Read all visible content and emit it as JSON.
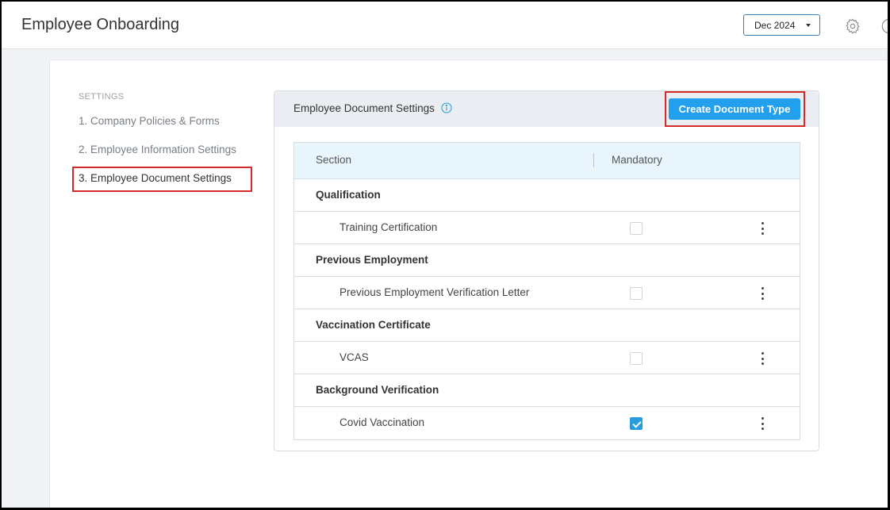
{
  "header": {
    "title": "Employee Onboarding",
    "period": "Dec 2024"
  },
  "sidebar": {
    "heading": "SETTINGS",
    "items": [
      {
        "label": "1. Company Policies & Forms"
      },
      {
        "label": "2. Employee Information Settings"
      },
      {
        "label": "3. Employee Document Settings"
      }
    ]
  },
  "card": {
    "title": "Employee Document Settings",
    "create_button": "Create Document Type"
  },
  "table": {
    "columns": [
      "Section",
      "Mandatory"
    ],
    "rows": [
      {
        "type": "group",
        "label": "Qualification"
      },
      {
        "type": "item",
        "label": "Training Certification",
        "mandatory": false
      },
      {
        "type": "group",
        "label": "Previous Employment"
      },
      {
        "type": "item",
        "label": "Previous Employment Verification Letter",
        "mandatory": false
      },
      {
        "type": "group",
        "label": "Vaccination Certificate"
      },
      {
        "type": "item",
        "label": "VCAS",
        "mandatory": false
      },
      {
        "type": "group",
        "label": "Background Verification"
      },
      {
        "type": "item",
        "label": "Covid Vaccination",
        "mandatory": true
      }
    ]
  },
  "icons": {
    "settings": "gear-icon",
    "help": "help-icon",
    "info": "info-icon",
    "row_menu": "kebab-menu-icon"
  },
  "colors": {
    "primary": "#22a0ee",
    "highlight": "#d62a2a",
    "checkbox_checked": "#2a9bdd",
    "table_header_bg": "#e8f5fd"
  }
}
